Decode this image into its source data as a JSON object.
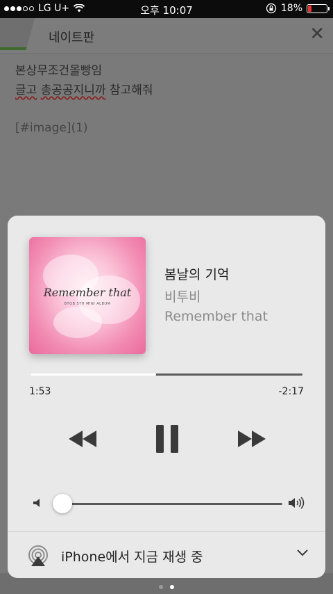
{
  "status_bar": {
    "carrier": "LG U+",
    "time": "오후 10:07",
    "battery": "18%",
    "battery_level": 0.18,
    "signal_bars_filled": 3,
    "signal_bars_total": 5
  },
  "note": {
    "title": "네이트판",
    "line1": "본상무조건몰빵임",
    "line2_a": "글고",
    "line2_b": "총공공지니까",
    "line2_c": " 참고해줘",
    "image_ref": "[#image](1)"
  },
  "player": {
    "song_title": "봄날의 기억",
    "artist": "비투비",
    "album": "Remember that",
    "album_art_title": "Remember that",
    "album_art_subtitle": "BTOB 5TH MINI ALBUM",
    "elapsed": "1:53",
    "remaining": "-2:17",
    "progress_fraction": 0.463,
    "volume_fraction": 0.04,
    "route_label": "iPhone에서 지금 재생 중"
  },
  "pager": {
    "active_index": 1,
    "count": 2
  },
  "colors": {
    "battery_low": "#e33333",
    "track": "#5a5a5a",
    "card": "#e9e9e9"
  },
  "icons": [
    "wifi-icon",
    "orientation-lock-icon",
    "rewind-icon",
    "pause-icon",
    "fast-forward-icon",
    "volume-low-icon",
    "volume-high-icon",
    "airplay-icon",
    "chevron-down-icon",
    "close-icon"
  ]
}
